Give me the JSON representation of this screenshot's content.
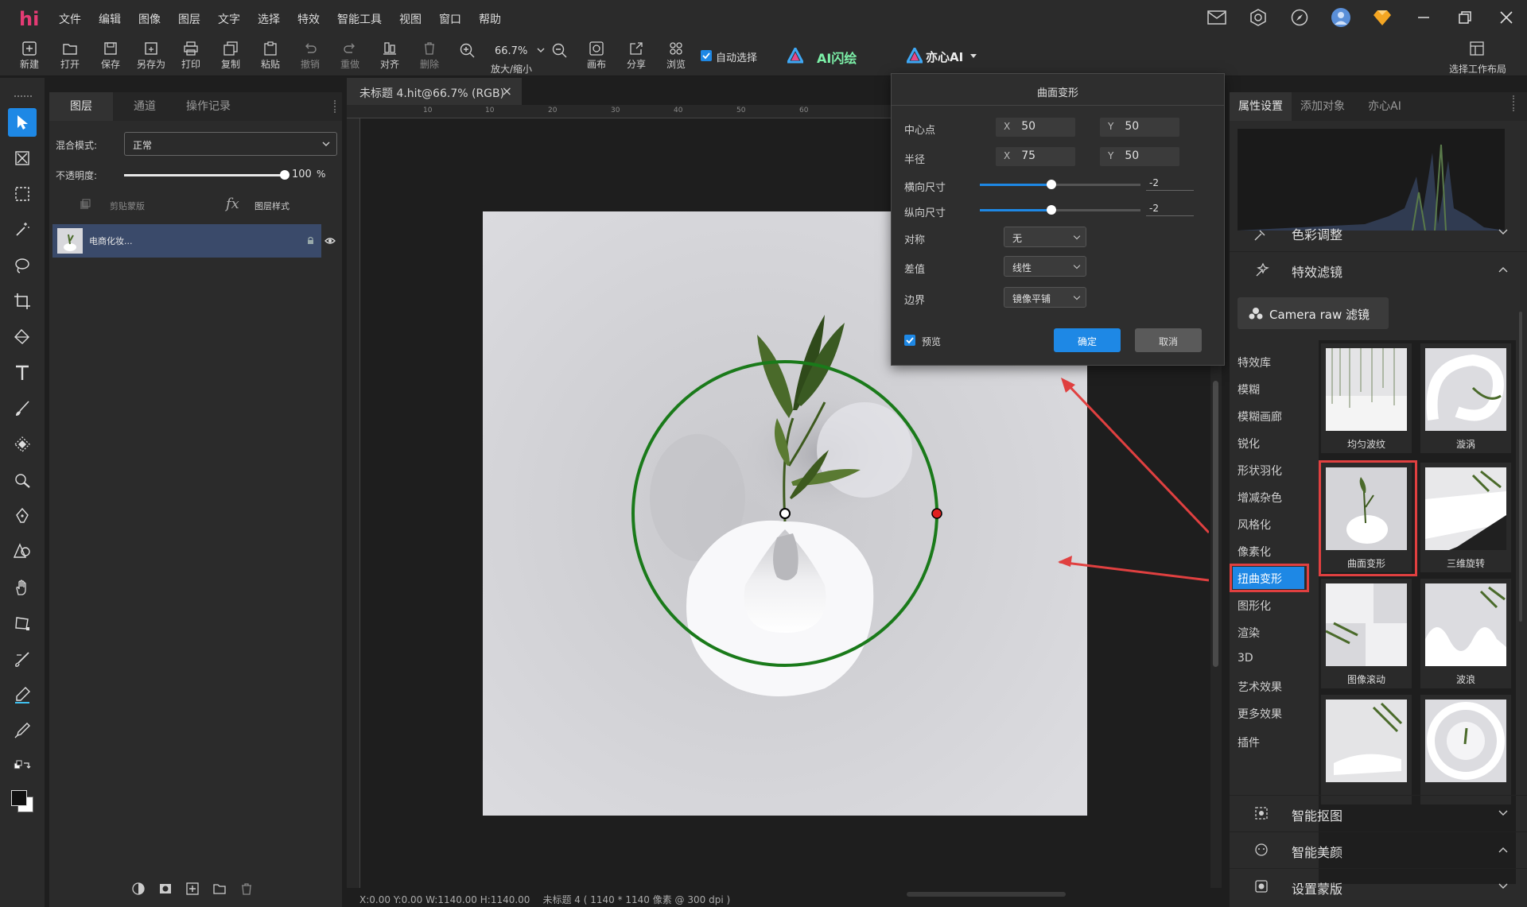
{
  "app": {
    "logo": "hi"
  },
  "menu": [
    "文件",
    "编辑",
    "图像",
    "图层",
    "文字",
    "选择",
    "特效",
    "智能工具",
    "视图",
    "窗口",
    "帮助"
  ],
  "toolbar": {
    "items": [
      "新建",
      "打开",
      "保存",
      "另存为",
      "打印",
      "复制",
      "粘贴",
      "撤销",
      "重做",
      "对齐",
      "删除"
    ],
    "zoom_value": "66.7%",
    "zoom_label": "放大/缩小",
    "items2": [
      "画布",
      "分享",
      "浏览"
    ],
    "auto_select": "自动选择",
    "ai_paint": "AI闪绘",
    "yixin_ai": "亦心AI",
    "workspace": "选择工作布局"
  },
  "layers_panel": {
    "tabs": [
      "图层",
      "通道",
      "操作记录"
    ],
    "blend_label": "混合模式:",
    "blend_value": "正常",
    "opacity_label": "不透明度:",
    "opacity_value": "100",
    "opacity_unit": "%",
    "opacity_fraction": 1.0,
    "clip_mask": "剪贴蒙版",
    "layer_style": "图层样式",
    "layer_name": "电商化妆..."
  },
  "document": {
    "tab_title": "未标题 4.hit@66.7% (RGB)",
    "ruler_top": [
      "10",
      "10",
      "20",
      "30",
      "40",
      "50",
      "60"
    ],
    "status_coords": "X:0.00 Y:0.00 W:1140.00 H:1140.00",
    "status_info": "未标题 4 ( 1140 * 1140 像素 @ 300 dpi )"
  },
  "dialog": {
    "title": "曲面变形",
    "center_label": "中心点",
    "center_x": "50",
    "center_y": "50",
    "radius_label": "半径",
    "radius_x": "75",
    "radius_y": "50",
    "x_tag": "X",
    "y_tag": "Y",
    "hsize_label": "横向尺寸",
    "hsize_value": "-2",
    "vsize_label": "纵向尺寸",
    "vsize_value": "-2",
    "symmetry_label": "对称",
    "symmetry_value": "无",
    "interp_label": "差值",
    "interp_value": "线性",
    "border_label": "边界",
    "border_value": "镜像平铺",
    "preview_label": "预览",
    "ok": "确定",
    "cancel": "取消"
  },
  "right_panel": {
    "tabs": [
      "属性设置",
      "添加对象",
      "亦心AI"
    ],
    "color_adjust": "色彩调整",
    "effects_filter": "特效滤镜",
    "camera_raw": "Camera raw 滤镜",
    "categories": [
      "特效库",
      "模糊",
      "模糊画廊",
      "锐化",
      "形状羽化",
      "增减杂色",
      "风格化",
      "像素化",
      "扭曲变形",
      "图形化",
      "渲染",
      "3D",
      "艺术效果",
      "更多效果",
      "插件"
    ],
    "selected_category": "扭曲变形",
    "thumbs": [
      "均匀波纹",
      "漩涡",
      "曲面变形",
      "三维旋转",
      "图像滚动",
      "波浪",
      "",
      ""
    ],
    "smart_cutout": "智能抠图",
    "smart_beauty": "智能美颜",
    "mask_settings": "设置蒙版"
  },
  "colors": {
    "accent": "#1e88e5",
    "highlight_red": "#e04040",
    "circle_green": "#1a7a1a"
  }
}
